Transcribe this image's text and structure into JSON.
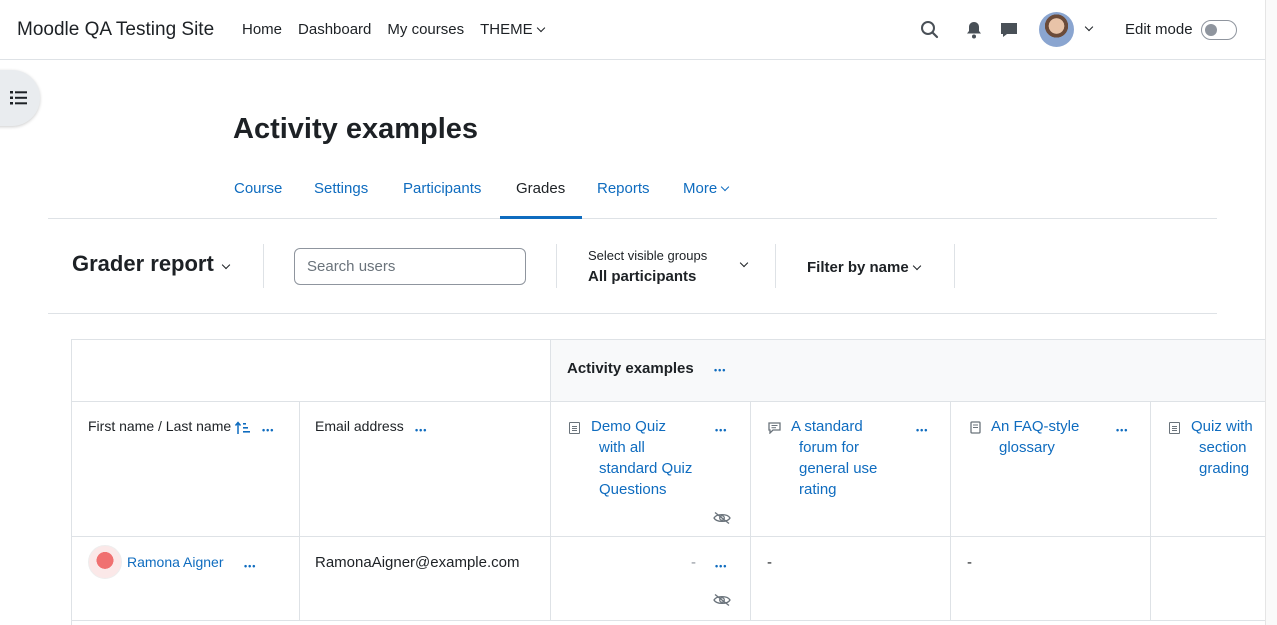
{
  "navbar": {
    "site_name": "Moodle QA Testing Site",
    "nav": [
      "Home",
      "Dashboard",
      "My courses",
      "THEME"
    ],
    "edit_mode_label": "Edit mode",
    "edit_mode_on": false
  },
  "page": {
    "title": "Activity examples",
    "tabs": [
      "Course",
      "Settings",
      "Participants",
      "Grades",
      "Reports",
      "More"
    ],
    "active_tab": "Grades"
  },
  "actionbar": {
    "report_title": "Grader report",
    "search_placeholder": "Search users",
    "groups_label": "Select visible groups",
    "groups_value": "All participants",
    "filter_label": "Filter by name"
  },
  "table": {
    "category": "Activity examples",
    "headers": {
      "name": "First name / Last name",
      "email": "Email address"
    },
    "activities": [
      {
        "title_lines": [
          "Demo Quiz",
          "with all",
          "standard Quiz",
          "Questions"
        ],
        "icon": "quiz-icon",
        "hidden": true
      },
      {
        "title_lines": [
          "A standard",
          "forum for",
          "general use",
          "rating"
        ],
        "icon": "forum-icon",
        "hidden": false
      },
      {
        "title_lines": [
          "An FAQ-style",
          "glossary"
        ],
        "icon": "glossary-icon",
        "hidden": false
      },
      {
        "title_lines": [
          "Quiz with",
          "section",
          "grading"
        ],
        "icon": "quiz-icon",
        "hidden": false
      }
    ],
    "rows": [
      {
        "name": "Ramona Aigner",
        "email": "RamonaAigner@example.com",
        "grades": [
          "-",
          "-",
          "-"
        ]
      }
    ]
  },
  "colors": {
    "link": "#0f6cbf",
    "text": "#1d2125",
    "border": "#dee2e6"
  }
}
